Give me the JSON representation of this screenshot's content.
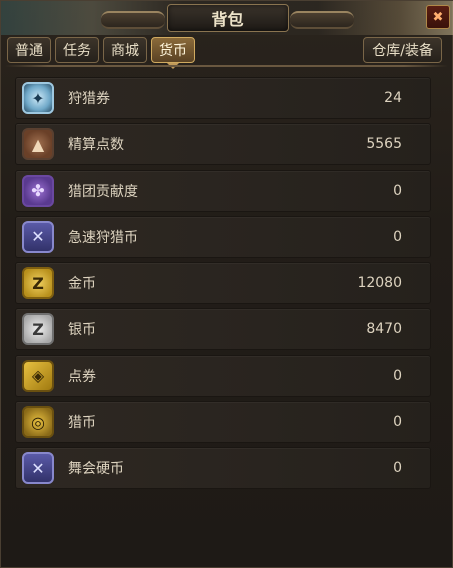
{
  "window": {
    "title": "背包",
    "close_icon": "close-icon"
  },
  "tabs": [
    {
      "label": "普通",
      "active": false
    },
    {
      "label": "任务",
      "active": false
    },
    {
      "label": "商城",
      "active": false
    },
    {
      "label": "货币",
      "active": true
    }
  ],
  "storage_button": "仓库/装备",
  "currencies": [
    {
      "name": "狩猎券",
      "value": "24",
      "icon": "hunt-ticket-icon",
      "glyph": "✦"
    },
    {
      "name": "精算点数",
      "value": "5565",
      "icon": "pile-icon",
      "glyph": "▲"
    },
    {
      "name": "猎团贡献度",
      "value": "0",
      "icon": "guild-emblem-icon",
      "glyph": "✤"
    },
    {
      "name": "急速狩猎币",
      "value": "0",
      "icon": "shield-icon",
      "glyph": "✕"
    },
    {
      "name": "金币",
      "value": "12080",
      "icon": "gold-coin-icon",
      "glyph": "Z"
    },
    {
      "name": "银币",
      "value": "8470",
      "icon": "silver-coin-icon",
      "glyph": "Z"
    },
    {
      "name": "点券",
      "value": "0",
      "icon": "ticket-tag-icon",
      "glyph": "◈"
    },
    {
      "name": "猎币",
      "value": "0",
      "icon": "hunt-coin-icon",
      "glyph": "◎"
    },
    {
      "name": "舞会硬币",
      "value": "0",
      "icon": "shield-icon",
      "glyph": "✕"
    }
  ]
}
